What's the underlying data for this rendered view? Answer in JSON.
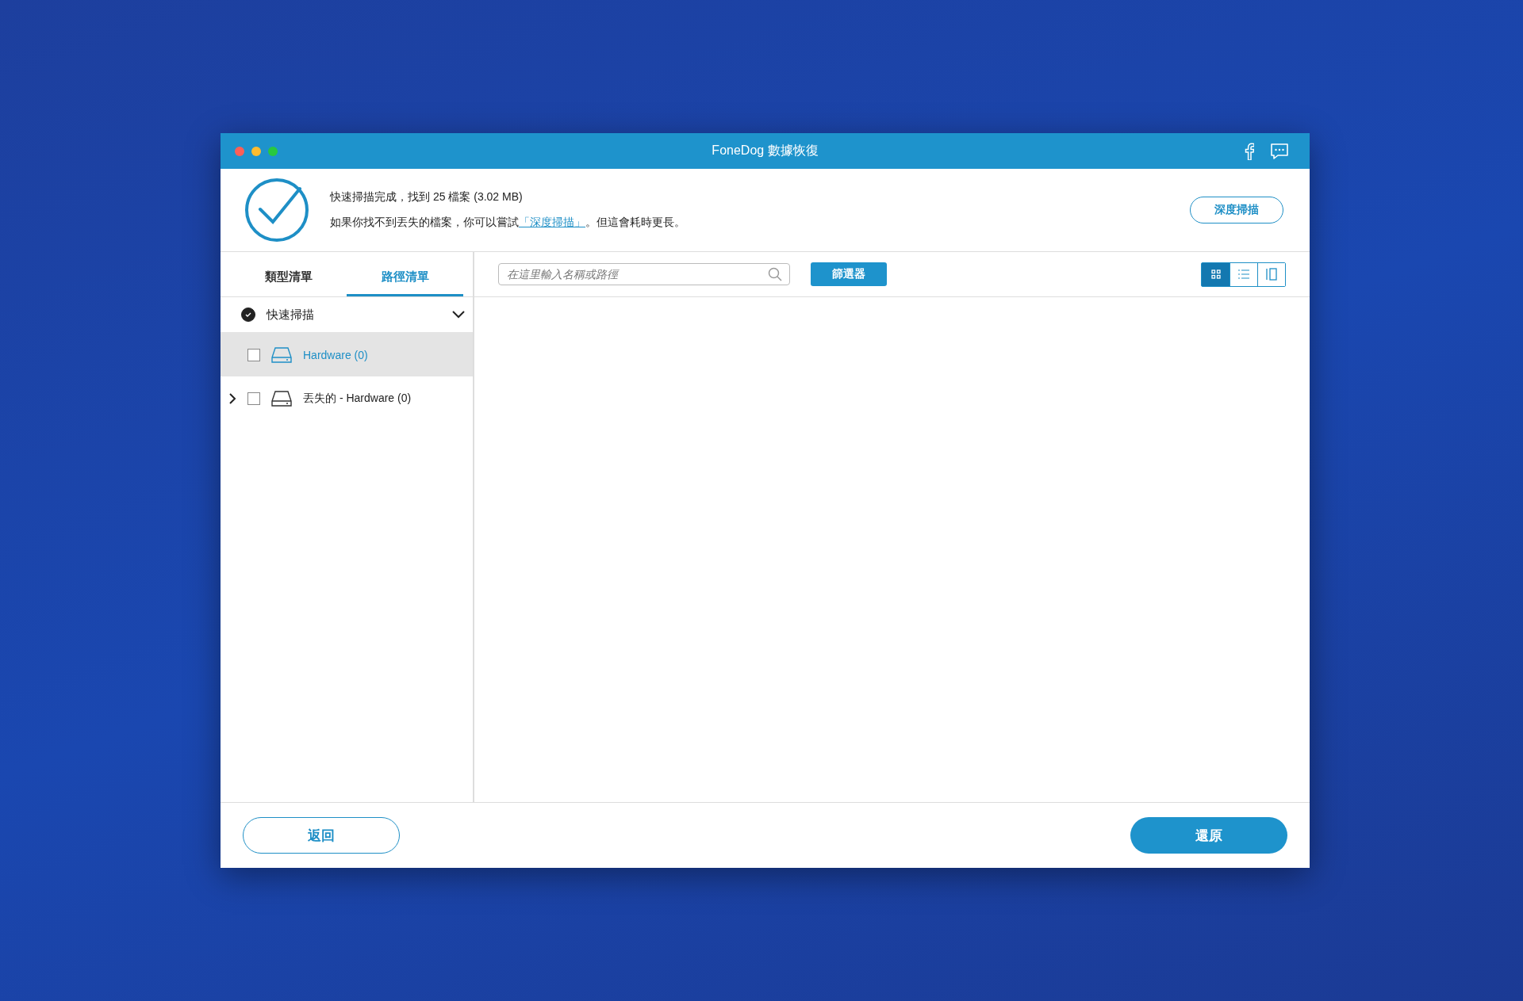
{
  "window": {
    "title": "FoneDog 數據恢復"
  },
  "header": {
    "status": "快速掃描完成，找到 25 檔案 (3.02 MB)",
    "hint_before": "如果你找不到丟失的檔案，你可以嘗試",
    "hint_link": "「深度掃描」",
    "hint_after": "。但這會耗時更長。",
    "deep_scan_button": "深度掃描"
  },
  "tabs": [
    {
      "label": "類型清單",
      "selected": false
    },
    {
      "label": "路徑清單",
      "selected": true
    }
  ],
  "tree": {
    "label": "快速掃描",
    "checked": true,
    "expanded": true,
    "children": [
      {
        "label": "Hardware (0)",
        "selected": true,
        "checked": false
      },
      {
        "label": "丟失的 - Hardware (0)",
        "selected": false,
        "checked": false,
        "expanded": false
      }
    ]
  },
  "search": {
    "placeholder": "在這里輸入名稱或路徑"
  },
  "filter_button": "篩選器",
  "view_modes": [
    {
      "kind": "grid",
      "selected": true
    },
    {
      "kind": "list",
      "selected": false
    },
    {
      "kind": "detail",
      "selected": false
    }
  ],
  "footer": {
    "back_button": "返回",
    "restore_button": "還原"
  }
}
